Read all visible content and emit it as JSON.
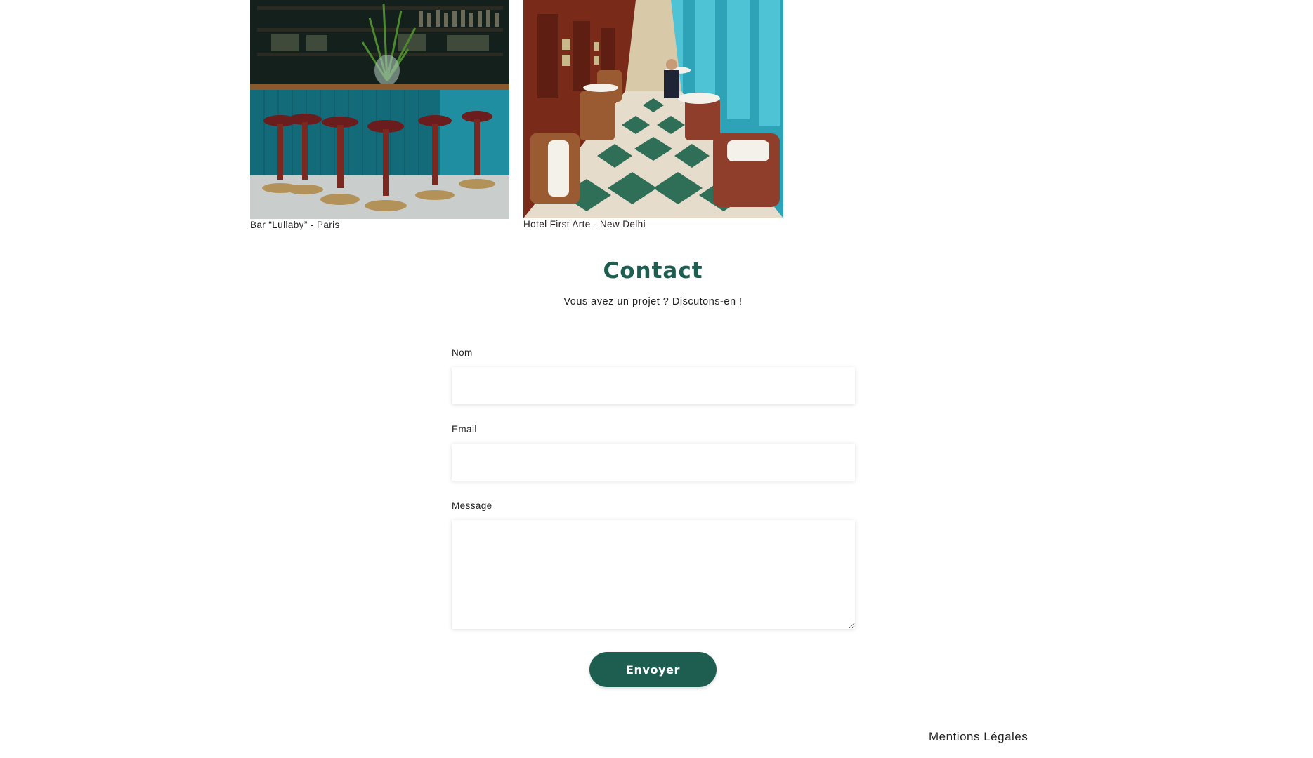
{
  "gallery": [
    {
      "caption": "Bar “Lullaby” - Paris",
      "image": "bar-interior-photo"
    },
    {
      "caption": "Hotel First Arte - New Delhi",
      "image": "hotel-dining-room-photo"
    }
  ],
  "contact": {
    "title": "Contact",
    "subtitle": "Vous avez un projet ? Discutons-en !"
  },
  "form": {
    "name_label": "Nom",
    "name_value": "",
    "email_label": "Email",
    "email_value": "",
    "message_label": "Message",
    "message_value": "",
    "submit_label": "Envoyer"
  },
  "footer": {
    "legal_link": "Mentions Légales"
  },
  "colors": {
    "accent": "#1e5e50",
    "background": "#ffffff",
    "text": "#222222"
  }
}
